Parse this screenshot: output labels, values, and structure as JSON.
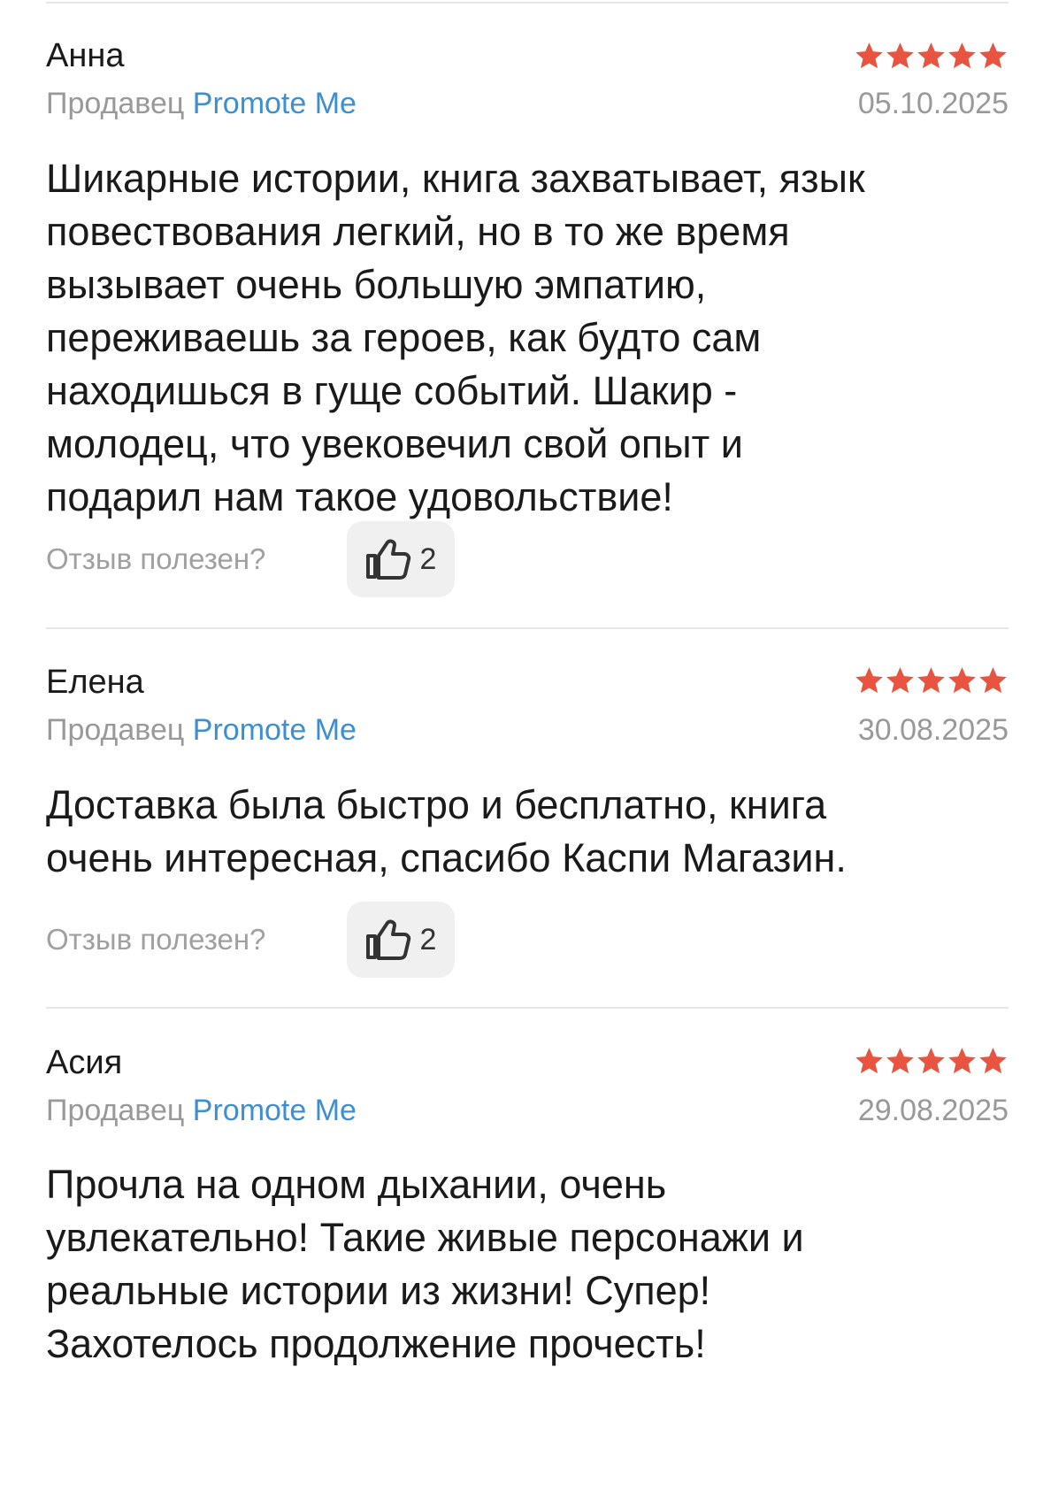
{
  "reviews": [
    {
      "author": "Анна",
      "rating": 5,
      "seller_prefix": "Продавец",
      "seller_name": "Promote Me",
      "date": "05.10.2025",
      "text_lines": [
        "Шикарные истории, книга захватывает, язык",
        "повествования легкий, но в то же время",
        "вызывает очень большую эмпатию,",
        "переживаешь за героев, как будто сам",
        "находишься в гуще событий. Шакир -",
        "молодец, что увековечил свой опыт и",
        "подарил нам такое удовольствие!"
      ],
      "helpful_label": "Отзыв полезен?",
      "likes": "2"
    },
    {
      "author": "Елена",
      "rating": 5,
      "seller_prefix": "Продавец",
      "seller_name": "Promote Me",
      "date": "30.08.2025",
      "text_lines": [
        "Доставка была быстро и бесплатно, книга",
        "очень интересная, спасибо Каспи Магазин."
      ],
      "helpful_label": "Отзыв полезен?",
      "likes": "2"
    },
    {
      "author": "Асия",
      "rating": 5,
      "seller_prefix": "Продавец",
      "seller_name": "Promote Me",
      "date": "29.08.2025",
      "text_lines": [
        "Прочла на одном дыхании, очень",
        "увлекательно! Такие живые персонажи и",
        "реальные истории из жизни! Супер!",
        "Захотелось продолжение прочесть!"
      ]
    }
  ],
  "colors": {
    "star": "#e8543f",
    "seller_link": "#3d8fd1",
    "muted": "#999999"
  },
  "icons": {
    "star": "star-icon",
    "like": "thumbs-up-icon"
  }
}
